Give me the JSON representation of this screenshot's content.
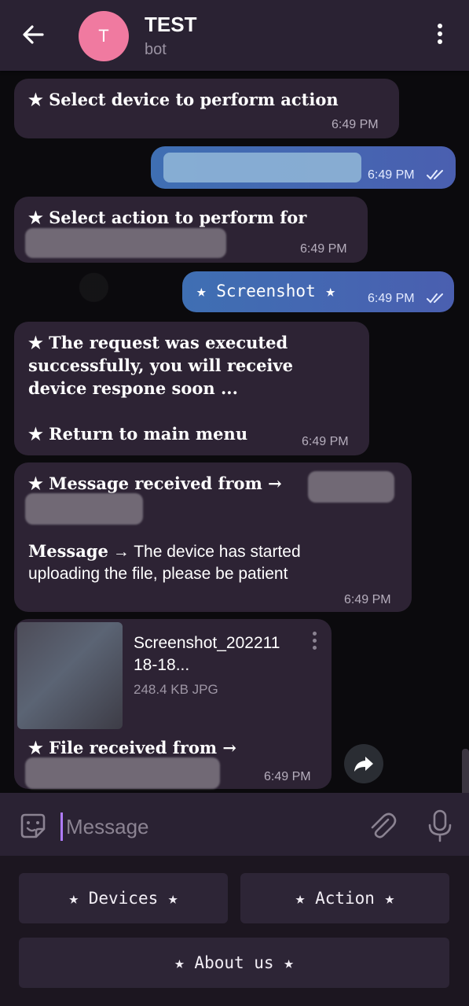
{
  "header": {
    "avatar_letter": "T",
    "title": "TEST",
    "subtitle": "bot"
  },
  "messages": [
    {
      "text": "★ Select device to perform action",
      "time": "6:49 PM"
    },
    {
      "time": "6:49 PM"
    },
    {
      "text": "★ Select action to perform for",
      "time": "6:49 PM"
    },
    {
      "text": "★ Screenshot ★",
      "time": "6:49 PM"
    },
    {
      "lines": [
        "★ The request was executed",
        "successfully, you will receive",
        "device respone soon ...",
        "",
        "★ Return to main menu"
      ],
      "time": "6:49 PM"
    },
    {
      "line1": "★ Message received from →",
      "label": "Message",
      "arrow": "→",
      "body1": "The device has started",
      "body2": "uploading the file, please be patient",
      "time": "6:49 PM"
    },
    {
      "file_name_1": "Screenshot_202211",
      "file_name_2": "18-18...",
      "file_meta": "248.4 KB JPG",
      "caption": "★ File received from →",
      "time": "6:49 PM"
    }
  ],
  "input": {
    "placeholder": "Message"
  },
  "keyboard": {
    "devices": "★ Devices ★",
    "action": "★ Action ★",
    "about": "★ About us ★"
  }
}
